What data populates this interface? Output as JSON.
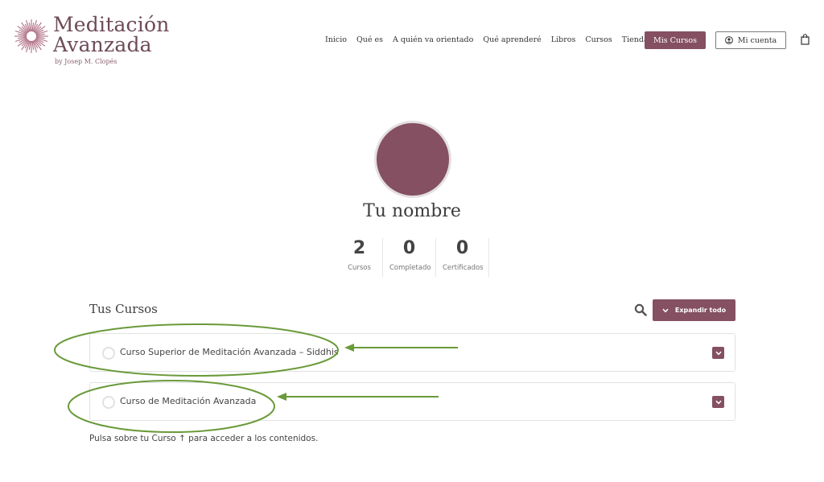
{
  "brand": {
    "title_line1": "Meditación",
    "title_line2": "Avanzada",
    "byline": "by Josep M. Clopés",
    "color": "#845062"
  },
  "nav": {
    "links": [
      "Inicio",
      "Qué es",
      "A quién va orientado",
      "Qué aprenderé",
      "Libros",
      "Cursos",
      "Tienda"
    ],
    "mis_cursos": "Mis Cursos",
    "mi_cuenta": "Mi cuenta",
    "icons": {
      "account": "user-circle-icon",
      "cart": "shopping-bag-icon"
    }
  },
  "profile": {
    "name": "Tu nombre",
    "stats": [
      {
        "value": "2",
        "label": "Cursos"
      },
      {
        "value": "0",
        "label": "Completado"
      },
      {
        "value": "0",
        "label": "Certificados"
      }
    ]
  },
  "courses": {
    "title": "Tus Cursos",
    "expand_all": "Expandir todo",
    "items": [
      {
        "label": "Curso Superior de Meditación Avanzada – Siddhis"
      },
      {
        "label": "Curso de Meditación Avanzada"
      }
    ],
    "footer": "Pulsa sobre tu Curso ↑ para acceder a los contenidos."
  },
  "annotation_color": "#6a9a3a"
}
